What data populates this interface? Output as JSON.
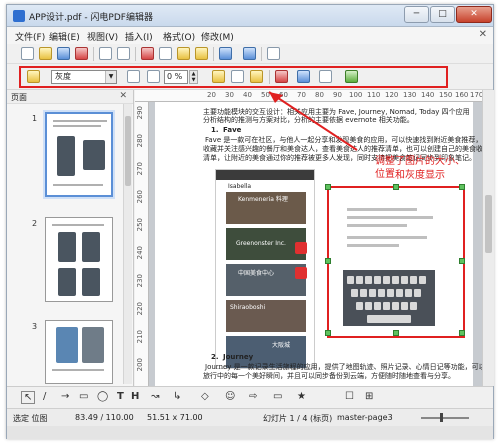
{
  "window": {
    "title": "APP设计.pdf - 闪电PDF编辑器",
    "controls": {
      "minimize": "─",
      "maximize": "□",
      "close": "✕"
    }
  },
  "menu": {
    "items": [
      "文件(F)",
      "编辑(E)",
      "视图(V)",
      "插入(I)",
      "格式(O)",
      "修改(M)"
    ],
    "close": "✕"
  },
  "toolbar2": {
    "mode_select": "灰度",
    "transparency": "0 %"
  },
  "sidebar": {
    "title": "页面",
    "close": "✕",
    "pages": [
      "1",
      "2",
      "3"
    ]
  },
  "ruler_h": [
    "20",
    "30",
    "40",
    "50",
    "60",
    "70",
    "80",
    "90",
    "100",
    "110",
    "120",
    "130",
    "140",
    "150",
    "160",
    "170"
  ],
  "ruler_v": [
    "200",
    "210",
    "220",
    "230",
    "240",
    "250",
    "260",
    "270",
    "280",
    "290"
  ],
  "document": {
    "intro_1": "主要功能模块的交互设计：相关应用主要为 Fave, Journey, Nomad, Today 四个应用",
    "intro_2": "分析结构的推测与方案对比，分析的主要依据 evernote 相关功能。",
    "item1_num": "1.",
    "item1_title": "Fave",
    "item1_p1": "Fave 是一款可在社区，与他人一起分享和发现美食的应用，可以快速找到附近美食推荐，",
    "item1_p2": "收藏并关注感兴趣的餐厅和美食达人，查看美食达人的推荐清单，也可以创建自己的美食收藏",
    "item1_p3": "清单，让附近的美食通过你的推荐被更多人发现，同时支持把美食笔记同步到印象笔记。",
    "item2_num": "2.",
    "item2_title": "Journey",
    "item2_p1": "Journey 是一款记录生活旅程的应用，提供了地图轨迹、照片记录、心情日记等功能，可以记录",
    "item2_p2": "旅行中的每一个美好瞬间，并且可以同步备份到云端，方便随时随地查看与分享。",
    "phone_user": "Isabella",
    "card1": "Kenmeneria 料理",
    "card2": "Greenonster Inc.",
    "card3": "中国美食中心",
    "card4": "Shiraoboshi",
    "card5": "大阪城"
  },
  "annotation": {
    "line1": "调整了图片的大小、位置",
    "line2": "和灰度显示"
  },
  "drawbar": [
    "↖",
    "/",
    "→",
    "▭",
    "◯",
    "T",
    "H",
    "↝",
    "↳",
    "◇",
    "☺",
    "⇨",
    "▭",
    "★",
    "☐",
    "⊞"
  ],
  "status": {
    "position_label": "选定 位图",
    "position": "83.49 / 110.00",
    "size": "51.51 x 71.00",
    "page": "幻灯片 1 / 4 (标页)",
    "master": "master-page3"
  },
  "colors": {
    "accent": "#e02020",
    "selection": "#5b8fd6"
  }
}
